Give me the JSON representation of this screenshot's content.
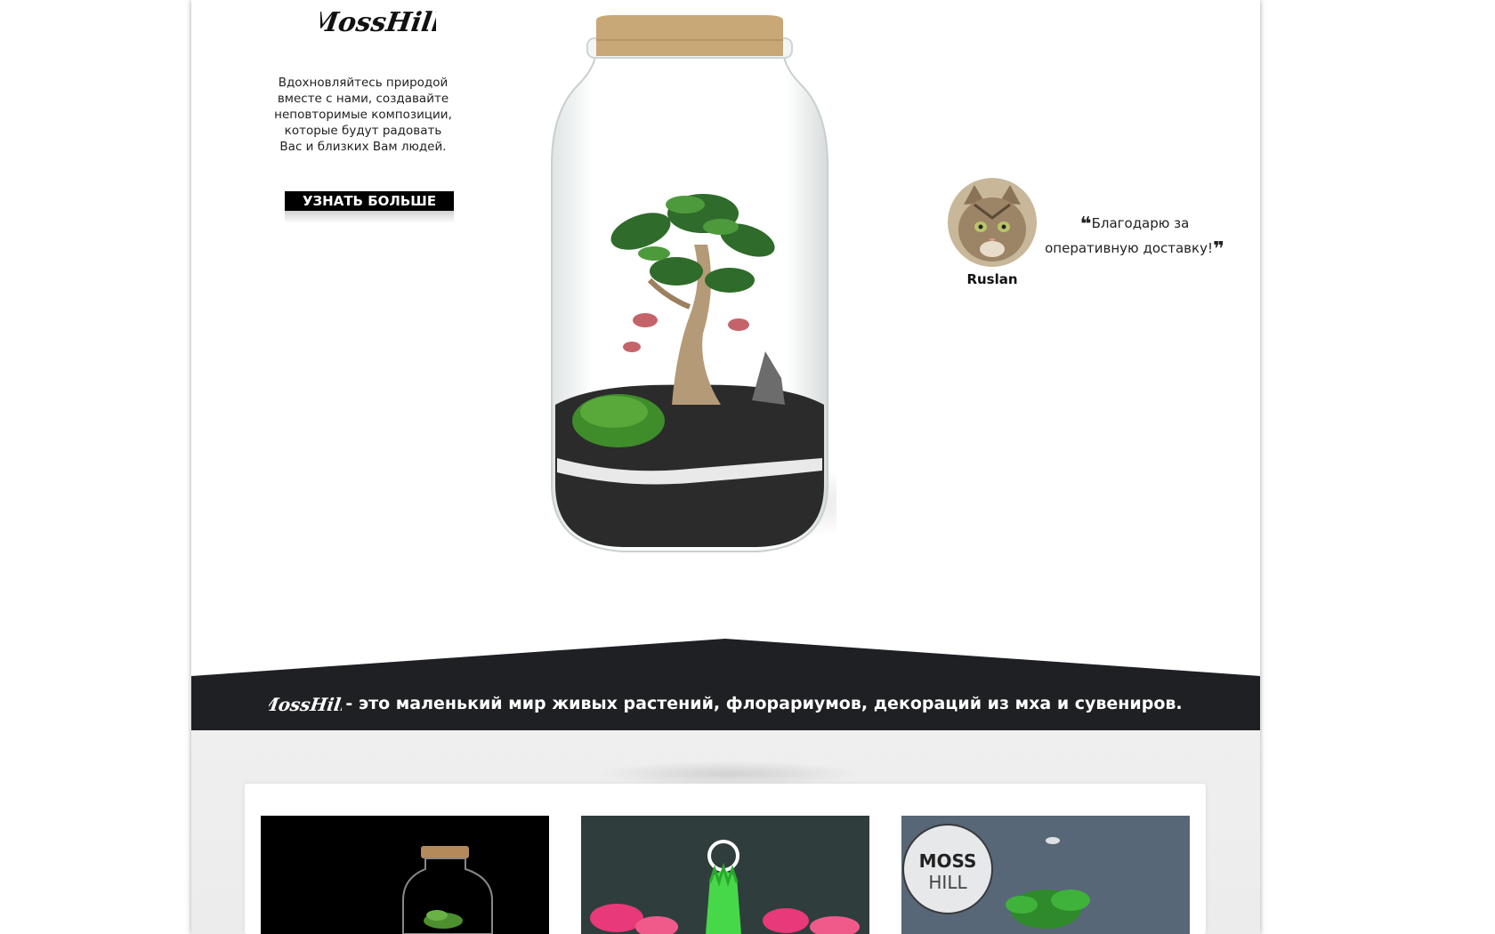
{
  "brand": {
    "logo_text": "MossHill"
  },
  "hero": {
    "tagline": "Вдохновляйтесь природой вместе с нами, создавайте неповторимые композиции, которые будут радовать Вас и близких Вам людей.",
    "cta_label": "УЗНАТЬ БОЛЬШЕ"
  },
  "testimonial": {
    "author": "Ruslan",
    "quote": "Благодарю за оперативную доставку!",
    "open_mark": "❝",
    "close_mark": "❞"
  },
  "band": {
    "logo_text": "MossHill",
    "text": "- это маленький мир живых растений, флорариумов, декораций из мха и сувениров.",
    "color": "#1f2024"
  },
  "gallery": {
    "items": [
      {
        "icon": "terrarium-dark-photo"
      },
      {
        "icon": "terrarium-neon-photo"
      },
      {
        "icon": "terrarium-mosshill-photo",
        "badge_text": "MOSS HILL"
      }
    ]
  }
}
